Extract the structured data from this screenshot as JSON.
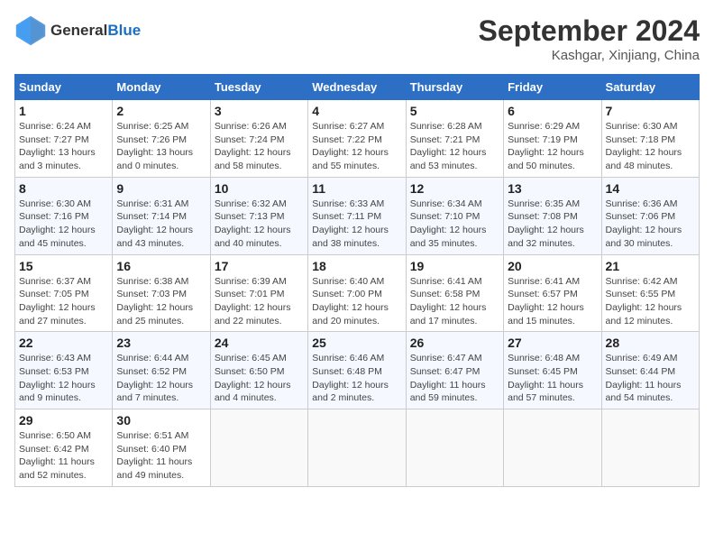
{
  "header": {
    "logo_general": "General",
    "logo_blue": "Blue",
    "month": "September 2024",
    "location": "Kashgar, Xinjiang, China"
  },
  "weekdays": [
    "Sunday",
    "Monday",
    "Tuesday",
    "Wednesday",
    "Thursday",
    "Friday",
    "Saturday"
  ],
  "weeks": [
    [
      {
        "day": "1",
        "sunrise": "Sunrise: 6:24 AM",
        "sunset": "Sunset: 7:27 PM",
        "daylight": "Daylight: 13 hours and 3 minutes."
      },
      {
        "day": "2",
        "sunrise": "Sunrise: 6:25 AM",
        "sunset": "Sunset: 7:26 PM",
        "daylight": "Daylight: 13 hours and 0 minutes."
      },
      {
        "day": "3",
        "sunrise": "Sunrise: 6:26 AM",
        "sunset": "Sunset: 7:24 PM",
        "daylight": "Daylight: 12 hours and 58 minutes."
      },
      {
        "day": "4",
        "sunrise": "Sunrise: 6:27 AM",
        "sunset": "Sunset: 7:22 PM",
        "daylight": "Daylight: 12 hours and 55 minutes."
      },
      {
        "day": "5",
        "sunrise": "Sunrise: 6:28 AM",
        "sunset": "Sunset: 7:21 PM",
        "daylight": "Daylight: 12 hours and 53 minutes."
      },
      {
        "day": "6",
        "sunrise": "Sunrise: 6:29 AM",
        "sunset": "Sunset: 7:19 PM",
        "daylight": "Daylight: 12 hours and 50 minutes."
      },
      {
        "day": "7",
        "sunrise": "Sunrise: 6:30 AM",
        "sunset": "Sunset: 7:18 PM",
        "daylight": "Daylight: 12 hours and 48 minutes."
      }
    ],
    [
      {
        "day": "8",
        "sunrise": "Sunrise: 6:30 AM",
        "sunset": "Sunset: 7:16 PM",
        "daylight": "Daylight: 12 hours and 45 minutes."
      },
      {
        "day": "9",
        "sunrise": "Sunrise: 6:31 AM",
        "sunset": "Sunset: 7:14 PM",
        "daylight": "Daylight: 12 hours and 43 minutes."
      },
      {
        "day": "10",
        "sunrise": "Sunrise: 6:32 AM",
        "sunset": "Sunset: 7:13 PM",
        "daylight": "Daylight: 12 hours and 40 minutes."
      },
      {
        "day": "11",
        "sunrise": "Sunrise: 6:33 AM",
        "sunset": "Sunset: 7:11 PM",
        "daylight": "Daylight: 12 hours and 38 minutes."
      },
      {
        "day": "12",
        "sunrise": "Sunrise: 6:34 AM",
        "sunset": "Sunset: 7:10 PM",
        "daylight": "Daylight: 12 hours and 35 minutes."
      },
      {
        "day": "13",
        "sunrise": "Sunrise: 6:35 AM",
        "sunset": "Sunset: 7:08 PM",
        "daylight": "Daylight: 12 hours and 32 minutes."
      },
      {
        "day": "14",
        "sunrise": "Sunrise: 6:36 AM",
        "sunset": "Sunset: 7:06 PM",
        "daylight": "Daylight: 12 hours and 30 minutes."
      }
    ],
    [
      {
        "day": "15",
        "sunrise": "Sunrise: 6:37 AM",
        "sunset": "Sunset: 7:05 PM",
        "daylight": "Daylight: 12 hours and 27 minutes."
      },
      {
        "day": "16",
        "sunrise": "Sunrise: 6:38 AM",
        "sunset": "Sunset: 7:03 PM",
        "daylight": "Daylight: 12 hours and 25 minutes."
      },
      {
        "day": "17",
        "sunrise": "Sunrise: 6:39 AM",
        "sunset": "Sunset: 7:01 PM",
        "daylight": "Daylight: 12 hours and 22 minutes."
      },
      {
        "day": "18",
        "sunrise": "Sunrise: 6:40 AM",
        "sunset": "Sunset: 7:00 PM",
        "daylight": "Daylight: 12 hours and 20 minutes."
      },
      {
        "day": "19",
        "sunrise": "Sunrise: 6:41 AM",
        "sunset": "Sunset: 6:58 PM",
        "daylight": "Daylight: 12 hours and 17 minutes."
      },
      {
        "day": "20",
        "sunrise": "Sunrise: 6:41 AM",
        "sunset": "Sunset: 6:57 PM",
        "daylight": "Daylight: 12 hours and 15 minutes."
      },
      {
        "day": "21",
        "sunrise": "Sunrise: 6:42 AM",
        "sunset": "Sunset: 6:55 PM",
        "daylight": "Daylight: 12 hours and 12 minutes."
      }
    ],
    [
      {
        "day": "22",
        "sunrise": "Sunrise: 6:43 AM",
        "sunset": "Sunset: 6:53 PM",
        "daylight": "Daylight: 12 hours and 9 minutes."
      },
      {
        "day": "23",
        "sunrise": "Sunrise: 6:44 AM",
        "sunset": "Sunset: 6:52 PM",
        "daylight": "Daylight: 12 hours and 7 minutes."
      },
      {
        "day": "24",
        "sunrise": "Sunrise: 6:45 AM",
        "sunset": "Sunset: 6:50 PM",
        "daylight": "Daylight: 12 hours and 4 minutes."
      },
      {
        "day": "25",
        "sunrise": "Sunrise: 6:46 AM",
        "sunset": "Sunset: 6:48 PM",
        "daylight": "Daylight: 12 hours and 2 minutes."
      },
      {
        "day": "26",
        "sunrise": "Sunrise: 6:47 AM",
        "sunset": "Sunset: 6:47 PM",
        "daylight": "Daylight: 11 hours and 59 minutes."
      },
      {
        "day": "27",
        "sunrise": "Sunrise: 6:48 AM",
        "sunset": "Sunset: 6:45 PM",
        "daylight": "Daylight: 11 hours and 57 minutes."
      },
      {
        "day": "28",
        "sunrise": "Sunrise: 6:49 AM",
        "sunset": "Sunset: 6:44 PM",
        "daylight": "Daylight: 11 hours and 54 minutes."
      }
    ],
    [
      {
        "day": "29",
        "sunrise": "Sunrise: 6:50 AM",
        "sunset": "Sunset: 6:42 PM",
        "daylight": "Daylight: 11 hours and 52 minutes."
      },
      {
        "day": "30",
        "sunrise": "Sunrise: 6:51 AM",
        "sunset": "Sunset: 6:40 PM",
        "daylight": "Daylight: 11 hours and 49 minutes."
      },
      null,
      null,
      null,
      null,
      null
    ]
  ]
}
